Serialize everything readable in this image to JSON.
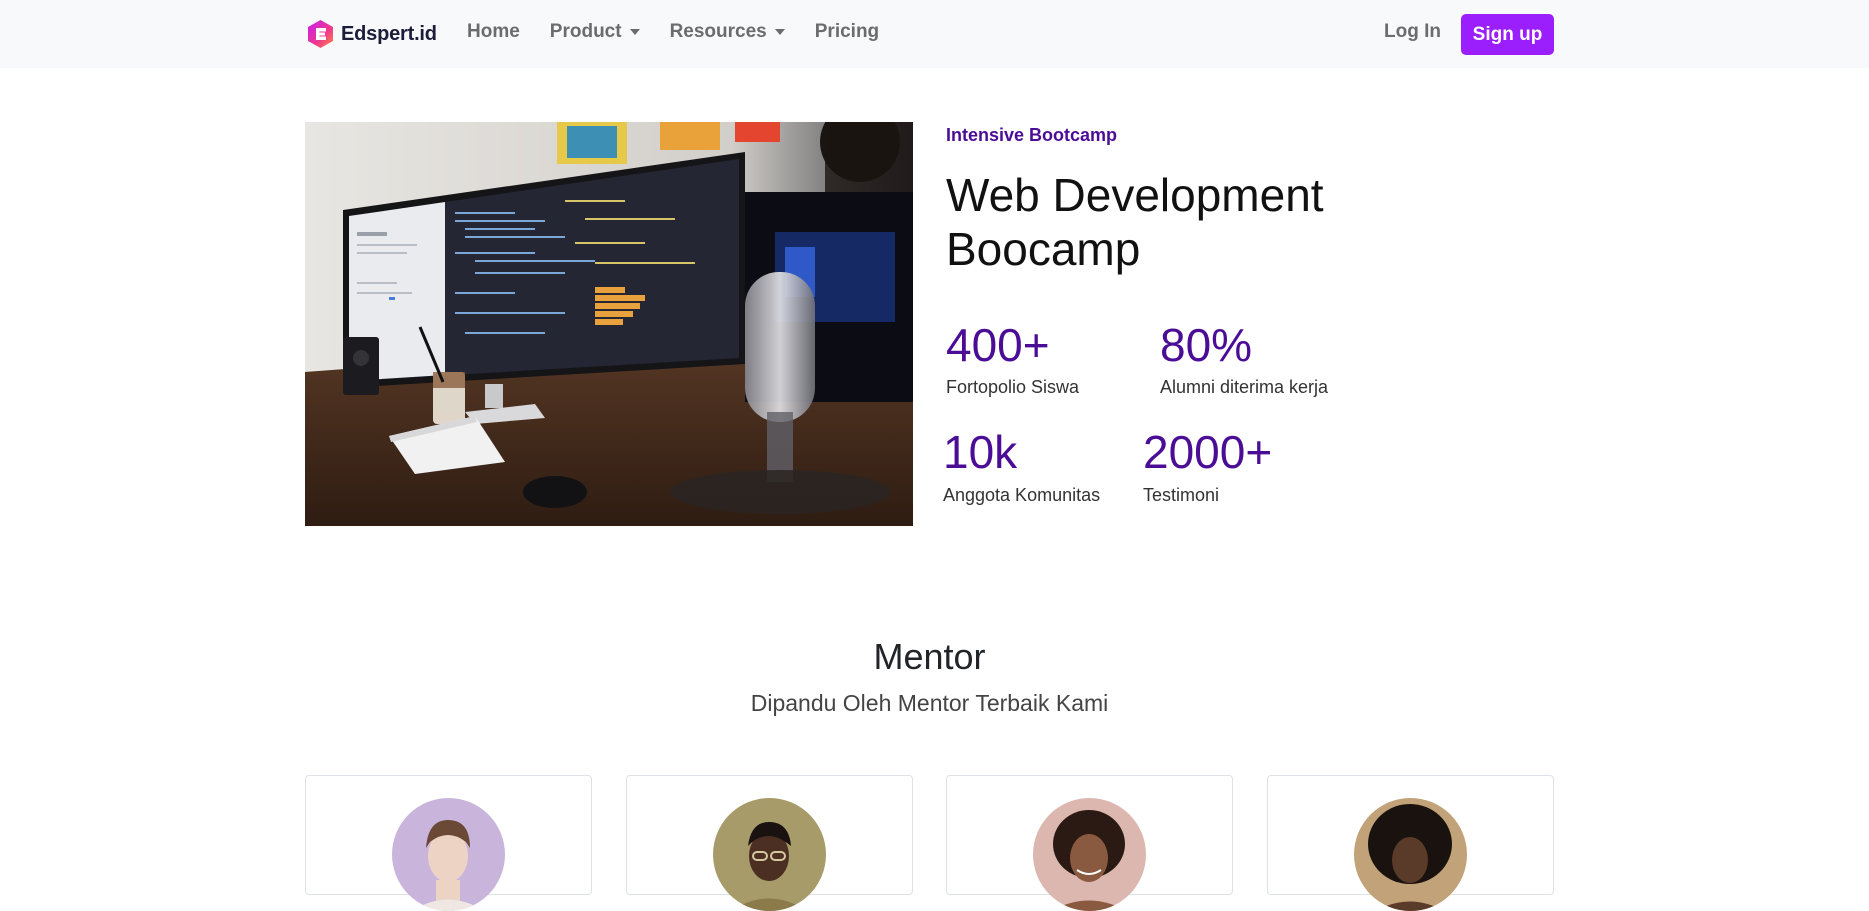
{
  "nav": {
    "brand": "Edspert.id",
    "links": [
      {
        "label": "Home",
        "dropdown": false
      },
      {
        "label": "Product",
        "dropdown": true
      },
      {
        "label": "Resources",
        "dropdown": true
      },
      {
        "label": "Pricing",
        "dropdown": false
      }
    ],
    "login_label": "Log In",
    "signup_label": "Sign up"
  },
  "hero": {
    "eyebrow": "Intensive Bootcamp",
    "title": "Web Development Boocamp",
    "stats": [
      {
        "value": "400+",
        "label": "Fortopolio Siswa"
      },
      {
        "value": "80%",
        "label": "Alumni diterima kerja"
      },
      {
        "value": "10k",
        "label": "Anggota Komunitas"
      },
      {
        "value": "2000+",
        "label": "Testimoni"
      }
    ]
  },
  "mentor_section": {
    "title": "Mentor",
    "subtitle": "Dipandu Oleh Mentor Terbaik Kami"
  },
  "colors": {
    "accent": "#9b1efc",
    "stat": "#4b0d96",
    "navbar_bg": "#f8f9fa"
  }
}
